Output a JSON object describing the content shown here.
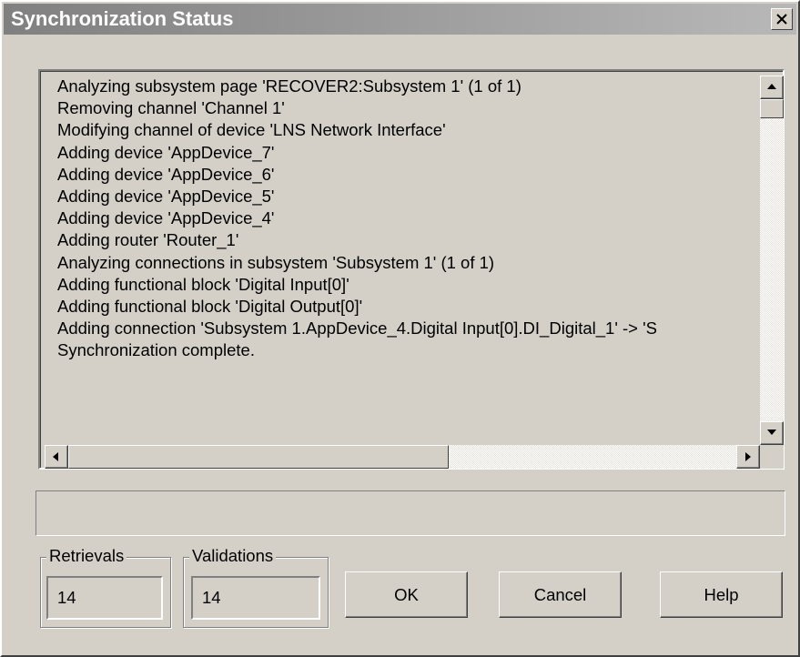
{
  "window": {
    "title": "Synchronization Status",
    "close_icon": "close-x-icon"
  },
  "log": {
    "lines": [
      "Analyzing subsystem page 'RECOVER2:Subsystem 1' (1 of 1)",
      "Removing channel 'Channel 1'",
      "Modifying channel of device 'LNS Network Interface'",
      "Adding device 'AppDevice_7'",
      "Adding device 'AppDevice_6'",
      "Adding device 'AppDevice_5'",
      "Adding device 'AppDevice_4'",
      "Adding router 'Router_1'",
      "Analyzing connections in subsystem 'Subsystem 1' (1 of 1)",
      "Adding functional block 'Digital Input[0]'",
      "Adding functional block 'Digital Output[0]'",
      "Adding connection 'Subsystem 1.AppDevice_4.Digital Input[0].DI_Digital_1' -> 'S",
      "Synchronization complete."
    ],
    "vertical_scroll": {
      "position": 0.0,
      "visible_fraction": 0.06
    },
    "horizontal_scroll": {
      "position": 0.0,
      "visible_fraction": 0.57
    }
  },
  "progress": {
    "value": 0.0
  },
  "retrievals": {
    "label": "Retrievals",
    "value": "14"
  },
  "validations": {
    "label": "Validations",
    "value": "14"
  },
  "buttons": {
    "ok": "OK",
    "cancel": "Cancel",
    "help": "Help"
  },
  "colors": {
    "dialog_face": "#d4d0c8",
    "titlebar_start": "#808080",
    "titlebar_end": "#b8b8b8",
    "title_text": "#ffffff"
  }
}
